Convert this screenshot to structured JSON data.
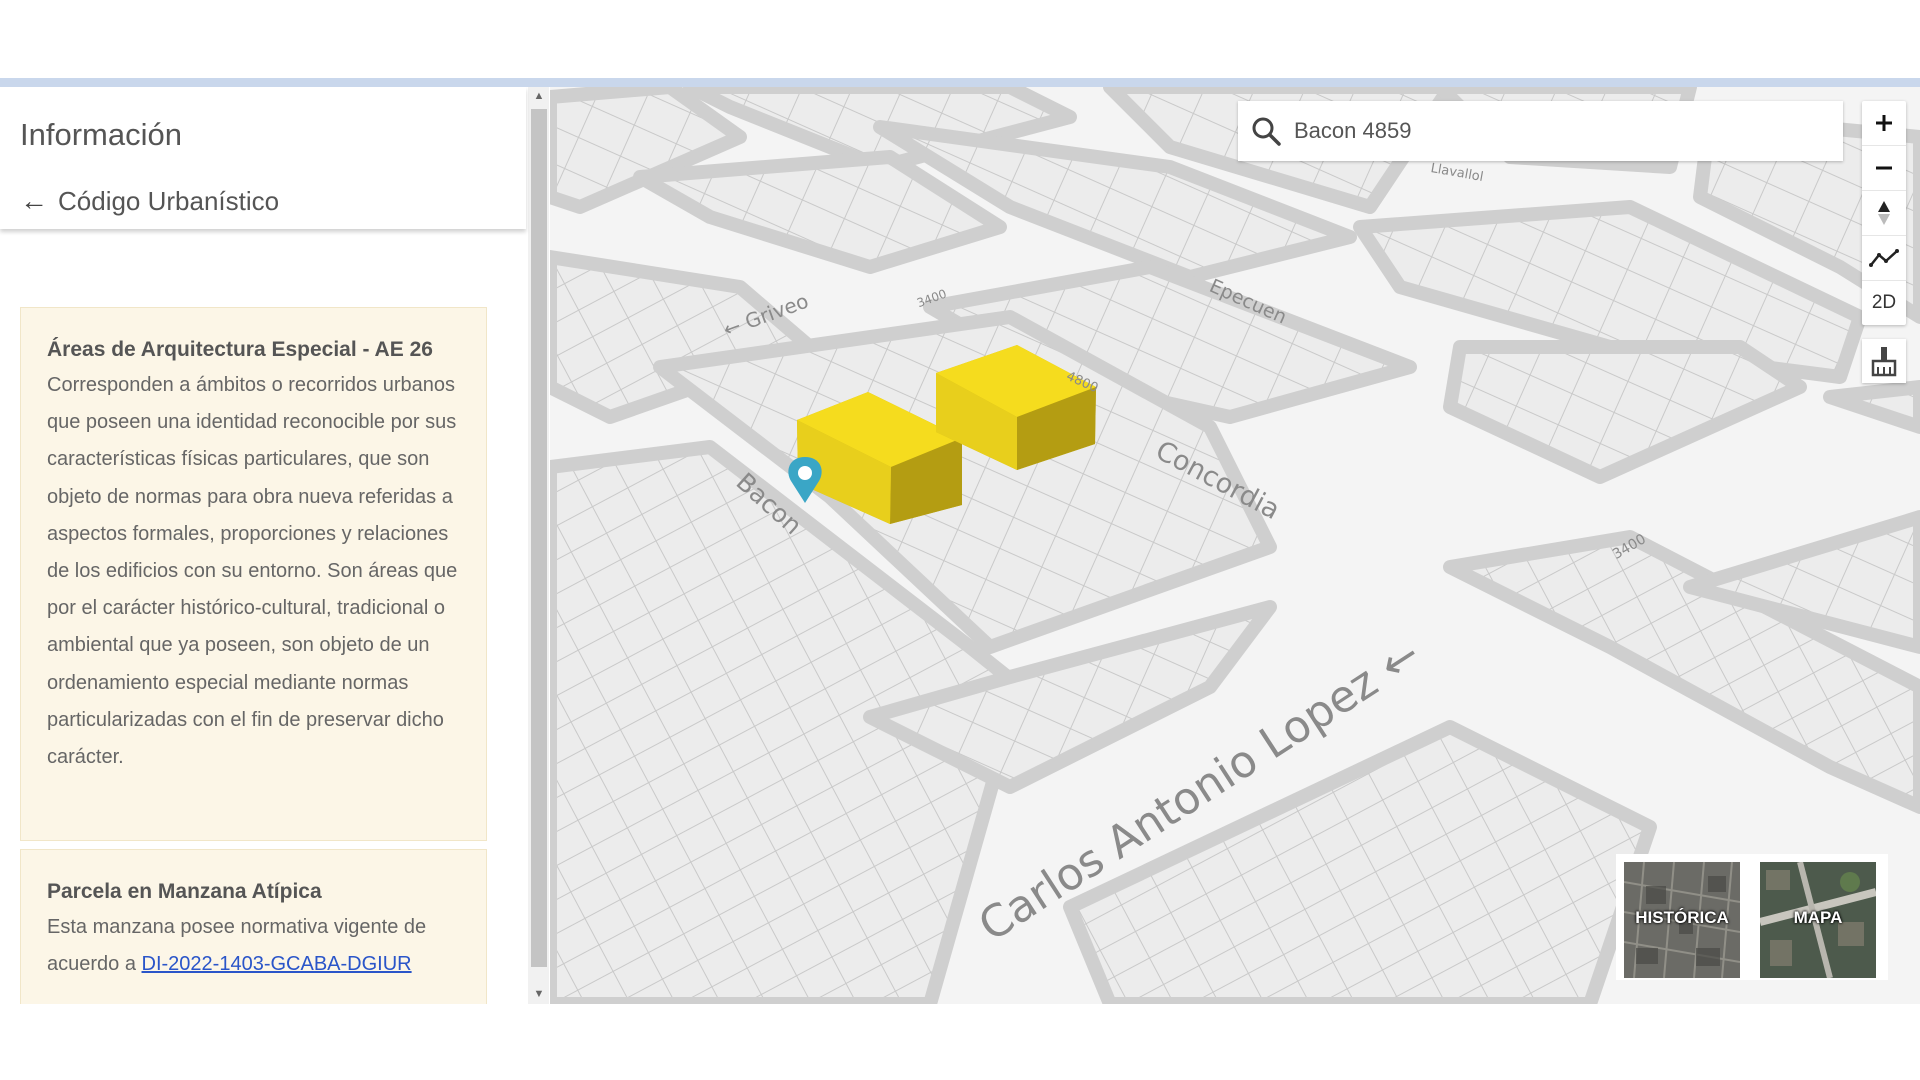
{
  "sidebar": {
    "title": "Información",
    "back_label": "Código Urbanístico",
    "cards": [
      {
        "title": "Áreas de Arquitectura Especial - AE 26",
        "body": "Corresponden a ámbitos o recorridos urbanos que poseen una identidad reconocible por sus características físicas particulares, que son objeto de normas para obra nueva referidas a aspectos formales, proporciones y relaciones de los edificios con su entorno. Son áreas que por el carácter histórico-cultural, tradicional o ambiental que ya poseen, son objeto de un ordenamiento especial mediante normas particularizadas con el fin de preservar dicho carácter."
      },
      {
        "title": "Parcela en Manzana Atípica",
        "body_prefix": "Esta manzana posee normativa vigente de acuerdo a ",
        "link_text": "DI-2022-1403-GCABA-DGIUR",
        "body_suffix": "."
      }
    ]
  },
  "search": {
    "value": "Bacon 4859",
    "icon": "search-icon"
  },
  "map_controls": {
    "zoom_in": "+",
    "zoom_out": "−",
    "compass": "compass-icon",
    "measure": "measure-icon",
    "mode_2d": "2D",
    "clear": "broom-icon"
  },
  "streets": {
    "griveo": "← Griveo",
    "epecuen": "Epecuen",
    "concordia": "Concordia",
    "bacon": "Bacon",
    "carlos_antonio_lopez": "Carlos Antonio Lopez ←",
    "lavallol": "Llavallol",
    "n3400_a": "3400",
    "n3400_b": "3400",
    "n4800": "4800"
  },
  "basemaps": {
    "historica": "HISTÓRICA",
    "mapa": "MAPA"
  },
  "colors": {
    "building_fill": "#f5dc1e",
    "marker": "#3aa6c6",
    "link": "#2a55c9",
    "card_bg": "#fcf6e7"
  }
}
